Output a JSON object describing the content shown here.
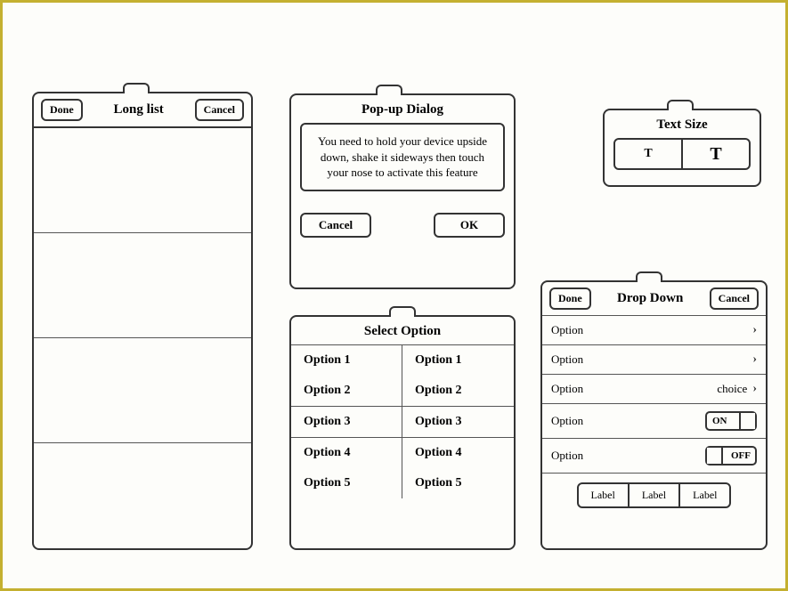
{
  "longList": {
    "title": "Long list",
    "done": "Done",
    "cancel": "Cancel"
  },
  "popup": {
    "title": "Pop-up Dialog",
    "message": "You need to hold your device upside down, shake it sideways then touch your nose to activate this feature",
    "cancel": "Cancel",
    "ok": "OK"
  },
  "textSize": {
    "title": "Text Size",
    "small": "T",
    "large": "T"
  },
  "selectOption": {
    "title": "Select Option",
    "col1": [
      "Option 1",
      "Option 2",
      "Option 3",
      "Option 4",
      "Option 5"
    ],
    "col2": [
      "Option 1",
      "Option 2",
      "Option 3",
      "Option 4",
      "Option 5"
    ]
  },
  "dropDown": {
    "title": "Drop Down",
    "done": "Done",
    "cancel": "Cancel",
    "rows": [
      {
        "label": "Option",
        "type": "nav"
      },
      {
        "label": "Option",
        "type": "nav"
      },
      {
        "label": "Option",
        "type": "choice",
        "value": "choice"
      },
      {
        "label": "Option",
        "type": "toggle",
        "value": "ON"
      },
      {
        "label": "Option",
        "type": "toggle",
        "value": "OFF"
      }
    ],
    "labels": [
      "Label",
      "Label",
      "Label"
    ]
  }
}
